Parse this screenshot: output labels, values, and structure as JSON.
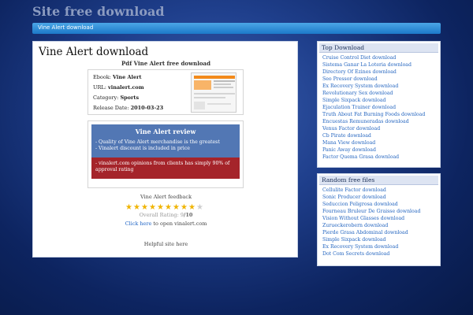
{
  "site": {
    "title": "Site free download"
  },
  "nav": {
    "breadcrumb": "Vine Alert download"
  },
  "main": {
    "title": "Vine Alert download",
    "subtitle": "Pdf Vine Alert free download",
    "info": {
      "ebook_label": "Ebook:",
      "ebook_value": "Vine Alert",
      "url_label": "URL:",
      "url_value": "vinalert.com",
      "category_label": "Category:",
      "category_value": "Sports",
      "release_label": "Release Date:",
      "release_value": "2010-03-23"
    },
    "review": {
      "title": "Vine Alert review",
      "pros": [
        "- Quality of Vine Alert merchandise is the greatest",
        "- Vinalert discount is included in price"
      ],
      "con": "- vinalert.com opinions from clients has simply 90% of approval rating"
    },
    "feedback_label": "Vine Alert feedback",
    "rating": {
      "value": 9,
      "max": 10,
      "label": "Overall Rating:",
      "value_text": "9",
      "max_text": "/10"
    },
    "click_link": "Click here",
    "click_suffix": " to open vinalert.com",
    "helpful": "Helpful site here"
  },
  "sidebar": {
    "top_download": {
      "title": "Top Download",
      "items": [
        "Cruise Control Diet download",
        "Sistema Ganar La Loteria download",
        "Directory Of Ezines download",
        "Seo Pressor download",
        "Ex Recovery System download",
        "Revolutionary Sex download",
        "Simple Sixpack download",
        "Ejaculation Trainer download",
        "Truth About Fat Burning Foods download",
        "Encuestas Remuneradas download",
        "Venus Factor download",
        "Cb Pirate download",
        "Mana View download",
        "Panic Away download",
        "Factor Quema Grasa download"
      ]
    },
    "random_files": {
      "title": "Random free files",
      "items": [
        "Cellulite Factor download",
        "Sonic Producer download",
        "Seduccion Peligrosa download",
        "Fourneau Bruleur De Graisse download",
        "Vision Without Glasses download",
        "Zurueckerobern download",
        "Pierde Grasa Abdominal download",
        "Simple Sixpack download",
        "Ex Recovery System download",
        "Dot Com Secrets download"
      ]
    }
  },
  "colors": {
    "background": "#1f3f8c",
    "nav_bar": "#2a8ad8",
    "review_blue": "#5277b4",
    "review_red": "#a5242a",
    "link": "#2566c0",
    "star": "#f0b400"
  }
}
